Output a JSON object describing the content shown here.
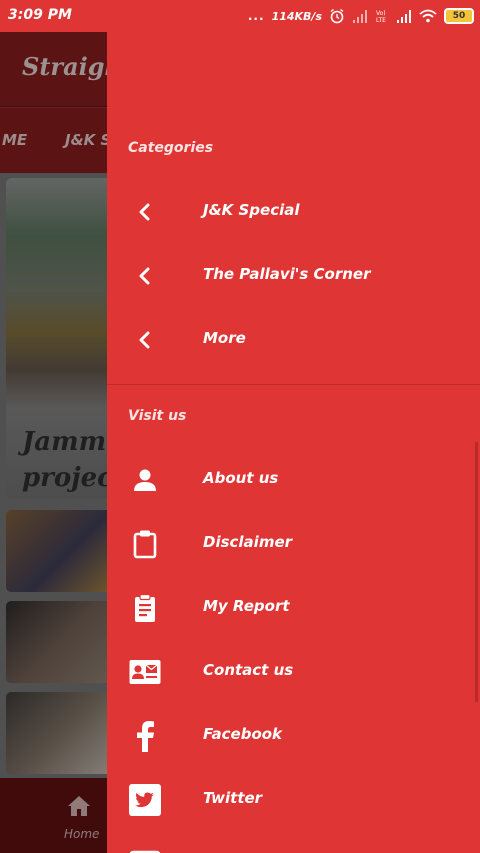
{
  "status_bar": {
    "time": "3:09 PM",
    "dots": "...",
    "speed": "114KB/s",
    "battery": "50"
  },
  "app": {
    "title": "Straigh",
    "tabs": [
      "ME",
      "J&K S"
    ],
    "hero_caption_line1": "Jammu",
    "hero_caption_line2": "project",
    "bottom_nav_label": "Home"
  },
  "drawer": {
    "categories_title": "Categories",
    "categories": [
      {
        "label": "J&K Special",
        "icon": "chevron-left-icon"
      },
      {
        "label": "The Pallavi's Corner",
        "icon": "chevron-left-icon"
      },
      {
        "label": "More",
        "icon": "chevron-left-icon"
      }
    ],
    "visit_title": "Visit us",
    "visit": [
      {
        "label": "About us",
        "icon": "person-icon"
      },
      {
        "label": "Disclaimer",
        "icon": "clipboard-icon"
      },
      {
        "label": "My Report",
        "icon": "report-icon"
      },
      {
        "label": "Contact us",
        "icon": "contact-card-icon"
      },
      {
        "label": "Facebook",
        "icon": "facebook-icon"
      },
      {
        "label": "Twitter",
        "icon": "twitter-icon"
      }
    ]
  },
  "colors": {
    "drawer_bg": "#e03535",
    "status_bar_bg": "#e03535",
    "app_toolbar_bg": "#7f1b1b"
  }
}
